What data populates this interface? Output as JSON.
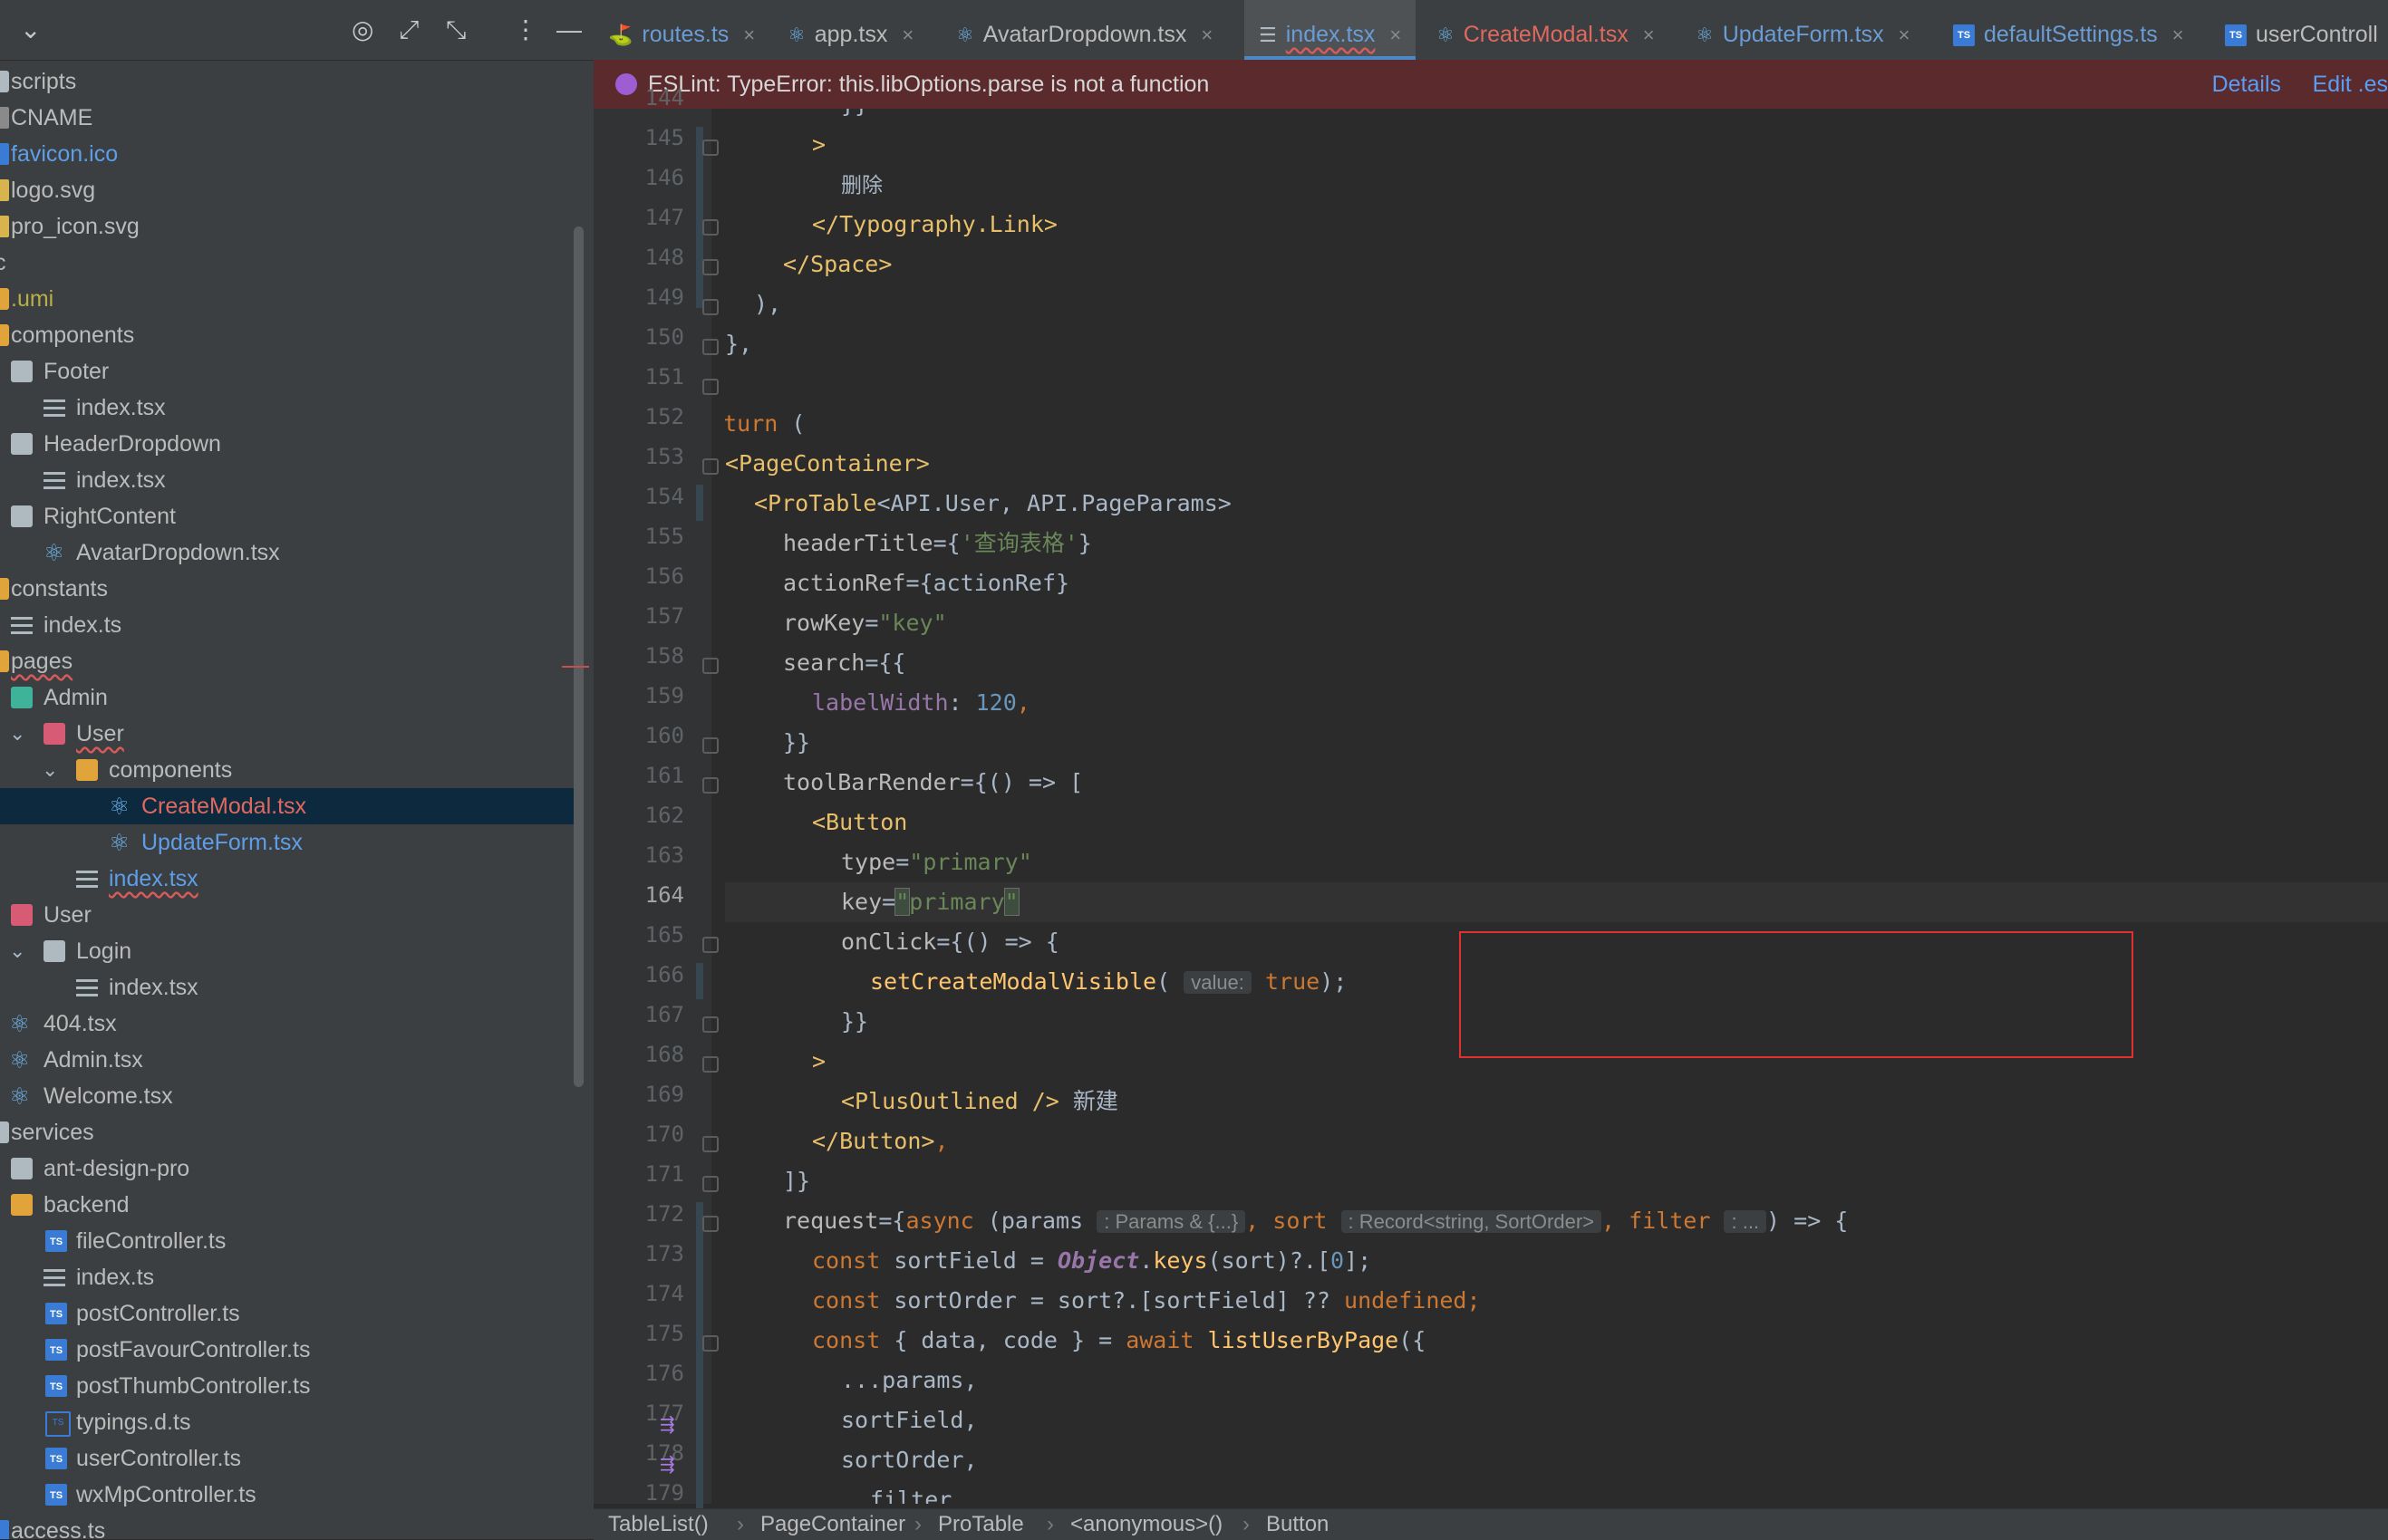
{
  "sidebar": {
    "toolbar": {
      "chevron": "⌄",
      "target": "◎",
      "expand": "⤢",
      "collapse": "⤡",
      "more": "⋮",
      "minimize": "—"
    },
    "items": [
      {
        "label": "scripts"
      },
      {
        "label": "CNAME"
      },
      {
        "label": "favicon.ico"
      },
      {
        "label": "logo.svg"
      },
      {
        "label": "pro_icon.svg"
      },
      {
        "label": "c"
      },
      {
        "label": ".umi"
      },
      {
        "label": "components"
      },
      {
        "label": "Footer"
      },
      {
        "label": "index.tsx"
      },
      {
        "label": "HeaderDropdown"
      },
      {
        "label": "index.tsx"
      },
      {
        "label": "RightContent"
      },
      {
        "label": "AvatarDropdown.tsx"
      },
      {
        "label": "constants"
      },
      {
        "label": "index.ts"
      },
      {
        "label": "pages"
      },
      {
        "label": "Admin"
      },
      {
        "label": "User"
      },
      {
        "label": "components"
      },
      {
        "label": "CreateModal.tsx"
      },
      {
        "label": "UpdateForm.tsx"
      },
      {
        "label": "index.tsx"
      },
      {
        "label": "User"
      },
      {
        "label": "Login"
      },
      {
        "label": "index.tsx"
      },
      {
        "label": "404.tsx"
      },
      {
        "label": "Admin.tsx"
      },
      {
        "label": "Welcome.tsx"
      },
      {
        "label": "services"
      },
      {
        "label": "ant-design-pro"
      },
      {
        "label": "backend"
      },
      {
        "label": "fileController.ts"
      },
      {
        "label": "index.ts"
      },
      {
        "label": "postController.ts"
      },
      {
        "label": "postFavourController.ts"
      },
      {
        "label": "postThumbController.ts"
      },
      {
        "label": "typings.d.ts"
      },
      {
        "label": "userController.ts"
      },
      {
        "label": "wxMpController.ts"
      },
      {
        "label": "access.ts"
      }
    ]
  },
  "tabs": [
    {
      "label": "routes.ts",
      "close": "×"
    },
    {
      "label": "app.tsx",
      "close": "×"
    },
    {
      "label": "AvatarDropdown.tsx",
      "close": "×"
    },
    {
      "label": "index.tsx",
      "close": "×"
    },
    {
      "label": "CreateModal.tsx",
      "close": "×"
    },
    {
      "label": "UpdateForm.tsx",
      "close": "×"
    },
    {
      "label": "defaultSettings.ts",
      "close": "×"
    },
    {
      "label": "userControll"
    }
  ],
  "lint": {
    "message": "ESLint: TypeError: this.libOptions.parse is not a function",
    "details": "Details",
    "edit": "Edit .es"
  },
  "gutter": {
    "lines": [
      "144",
      "145",
      "146",
      "147",
      "148",
      "149",
      "150",
      "151",
      "152",
      "153",
      "154",
      "155",
      "156",
      "157",
      "158",
      "159",
      "160",
      "161",
      "162",
      "163",
      "164",
      "165",
      "166",
      "167",
      "168",
      "169",
      "170",
      "171",
      "172",
      "173",
      "174",
      "175",
      "176",
      "177",
      "178",
      "179"
    ]
  },
  "code": {
    "l144": "}}",
    "l145": ">",
    "l146": "删除",
    "l147_tag": "</Typography.Link>",
    "l148_tag": "</Space>",
    "l149": "),",
    "l150": "},",
    "l151": "];",
    "l152_kw": "return",
    "l152_rest": " (",
    "l153_tag": "<PageContainer>",
    "l154_tag": "<ProTable",
    "l154_rest": "<API.User, API.PageParams>",
    "l155_attr": "headerTitle",
    "l155_rest": "={",
    "l155_str": "'查询表格'",
    "l155_end": "}",
    "l156_attr": "actionRef",
    "l156_rest": "={actionRef}",
    "l157_attr": "rowKey",
    "l157_rest": "=",
    "l157_str": "\"key\"",
    "l158_attr": "search",
    "l158_rest": "={{",
    "l159_prop": "labelWidth",
    "l159_rest": ": ",
    "l159_num": "120",
    "l159_end": ",",
    "l160": "}}",
    "l161_attr": "toolBarRender",
    "l161_rest": "={() => [",
    "l162_tag": "<Button",
    "l163_attr": "type",
    "l163_rest": "=",
    "l163_str": "\"primary\"",
    "l164_attr": "key",
    "l164_rest": "=",
    "l164_q1": "\"",
    "l164_str": "primary",
    "l164_q2": "\"",
    "l165_attr": "onClick",
    "l165_rest": "={() => {",
    "l166_fn": "setCreateModalVisible",
    "l166_open": "(",
    "l166_hint": "value:",
    "l166_kw": "true",
    "l166_end": ");",
    "l167": "}}",
    "l168_tag": ">",
    "l169_tag": "<PlusOutlined />",
    "l169_rest": " 新建",
    "l170_tag": "</Button>",
    "l170_rest": ",",
    "l171": "]}",
    "l172_attr": "request",
    "l172_a": "={",
    "l172_kw": "async",
    "l172_b": " (params",
    "l172_hint1": ": Params & {...}",
    "l172_c": ", sort",
    "l172_hint2": ": Record<string, SortOrder>",
    "l172_d": ", filter",
    "l172_hint3": ": ...",
    "l172_e": ") => {",
    "l173_kw": "const",
    "l173_a": " sortField = ",
    "l173_obj": "Object",
    "l173_b": ".",
    "l173_fn": "keys",
    "l173_c": "(sort)?.[",
    "l173_num": "0",
    "l173_d": "];",
    "l174_kw": "const",
    "l174_a": " sortOrder = sort?.[sortField] ?? ",
    "l174_kw2": "undefined",
    "l174_b": ";",
    "l175_kw": "const",
    "l175_a": " { data, code } = ",
    "l175_kw2": "await",
    "l175_fn": " listUserByPage",
    "l175_b": "({",
    "l176": "...params,",
    "l177": "sortField,",
    "l178": "sortOrder,",
    "l179": "filter,"
  },
  "breadcrumb": [
    {
      "label": "TableList()"
    },
    {
      "label": "PageContainer"
    },
    {
      "label": "ProTable"
    },
    {
      "label": "<anonymous>()"
    },
    {
      "label": "Button"
    }
  ],
  "colors": {
    "accent": "#4a88c7",
    "error_bar": "#5b2a2c",
    "highlight_box": "#e03030"
  }
}
